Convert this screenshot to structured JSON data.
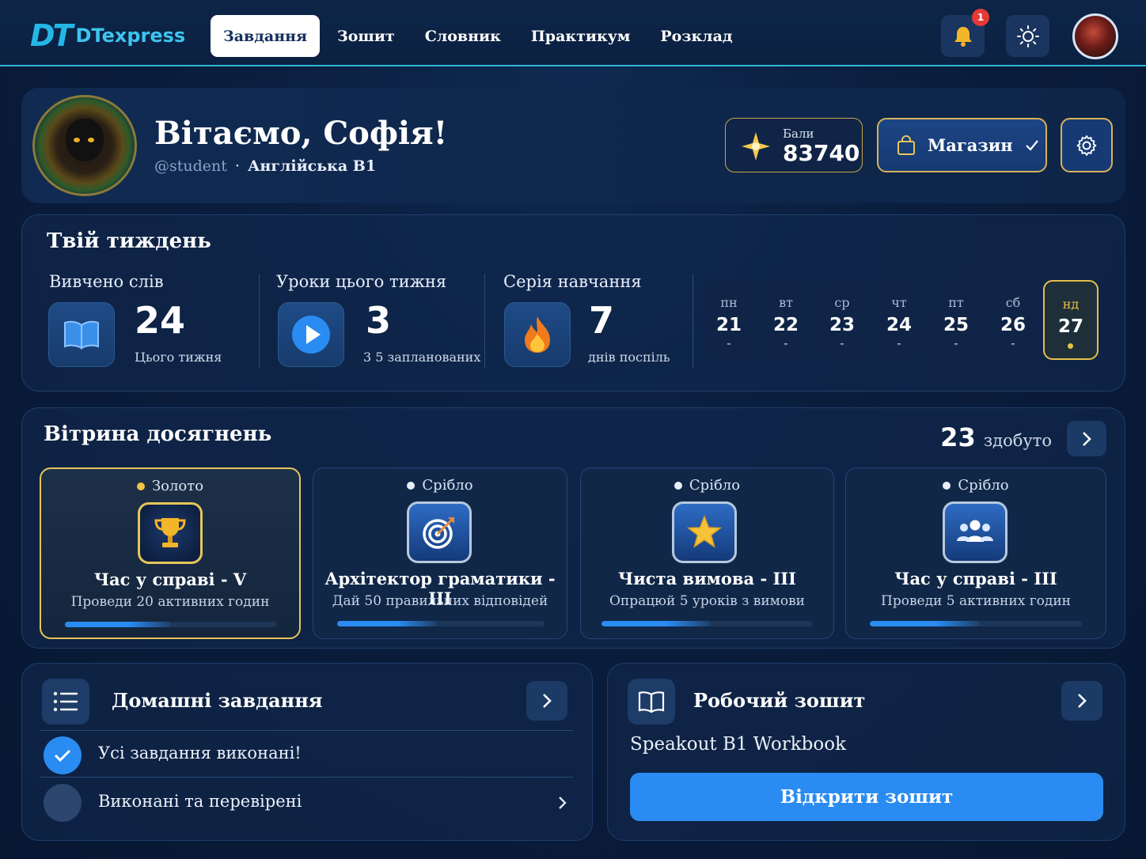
{
  "app": {
    "logo_mark": "DT",
    "logo_text": "DTexpress"
  },
  "nav": {
    "items": [
      {
        "label": "Завдання",
        "active": true
      },
      {
        "label": "Зошит",
        "active": false
      },
      {
        "label": "Словник",
        "active": false
      },
      {
        "label": "Практикум",
        "active": false
      },
      {
        "label": "Розклад",
        "active": false
      }
    ],
    "notifications_count": "1"
  },
  "welcome": {
    "title": "Вітаємо, Софія!",
    "handle": "@student",
    "separator": "·",
    "course": "Англійська B1",
    "points_label": "Бали",
    "points_value": "83740",
    "shop_label": "Магазин"
  },
  "week": {
    "title": "Твій тиждень",
    "stats": [
      {
        "label": "Вивчено слів",
        "value": "24",
        "caption": "Цього тижня",
        "icon": "book-icon"
      },
      {
        "label": "Уроки цього тижня",
        "value": "3",
        "caption": "3 5 запланованих",
        "icon": "play-icon"
      },
      {
        "label": "Серія навчання",
        "value": "7",
        "caption": "днів поспіль",
        "icon": "fire-icon"
      }
    ],
    "days": [
      {
        "name": "пн",
        "date": "21",
        "mark": "-"
      },
      {
        "name": "вт",
        "date": "22",
        "mark": "-"
      },
      {
        "name": "ср",
        "date": "23",
        "mark": "-"
      },
      {
        "name": "чт",
        "date": "24",
        "mark": "-"
      },
      {
        "name": "пт",
        "date": "25",
        "mark": "-"
      },
      {
        "name": "сб",
        "date": "26",
        "mark": "-"
      },
      {
        "name": "нд",
        "date": "27",
        "mark": "",
        "today": true
      }
    ]
  },
  "achievements": {
    "title": "Вітрина досягнень",
    "count": "23",
    "count_label": "здобуто",
    "items": [
      {
        "tier": "Золото",
        "name": "Час у справі - V",
        "desc": "Проведи 20 активних годин",
        "icon": "trophy-icon",
        "progress": 0.5
      },
      {
        "tier": "Срібло",
        "name": "Архітектор граматики - III",
        "desc": "Дай 50 правильних відповідей",
        "icon": "target-icon",
        "progress": 0.48
      },
      {
        "tier": "Срібло",
        "name": "Чиста вимова - III",
        "desc": "Опрацюй 5 уроків з вимови",
        "icon": "star-icon",
        "progress": 0.52
      },
      {
        "tier": "Срібло",
        "name": "Час у справі - III",
        "desc": "Проведи 5 активних годин",
        "icon": "users-icon",
        "progress": 0.52
      }
    ]
  },
  "homework": {
    "title": "Домашні завдання",
    "rows": [
      {
        "text": "Усі завдання виконані!",
        "done": true
      },
      {
        "text": "Виконані та перевірені",
        "done": false
      }
    ]
  },
  "workbook": {
    "title": "Робочий зошит",
    "book": "Speakout B1 Workbook",
    "button": "Відкрити зошит"
  },
  "colors": {
    "accent": "#2a8cf2",
    "gold": "#e6c55a",
    "background": "#0a1d3d",
    "badge": "#e53935"
  }
}
